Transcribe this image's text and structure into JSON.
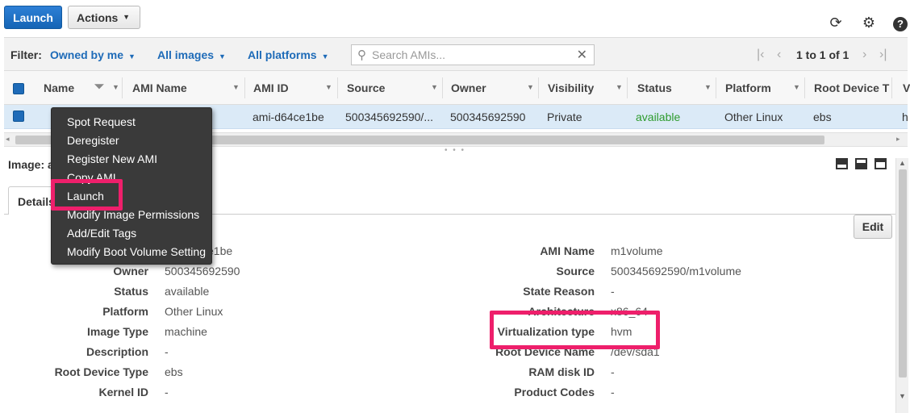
{
  "toolbar": {
    "launch_label": "Launch",
    "actions_label": "Actions",
    "refresh_icon": "refresh-icon",
    "settings_icon": "gear-icon",
    "help_icon": "help-icon"
  },
  "filter": {
    "label": "Filter:",
    "owned": "Owned by me",
    "images": "All images",
    "platforms": "All platforms",
    "search_placeholder": "Search AMIs...",
    "pager_text": "1 to 1 of 1"
  },
  "table": {
    "columns": [
      "Name",
      "AMI Name",
      "AMI ID",
      "Source",
      "Owner",
      "Visibility",
      "Status",
      "Platform",
      "Root Device T",
      "V"
    ],
    "row": {
      "ami_id": "ami-d64ce1be",
      "source": "500345692590/...",
      "owner": "500345692590",
      "visibility": "Private",
      "status": "available",
      "platform": "Other Linux",
      "root_device": "ebs",
      "v": "h"
    }
  },
  "context_menu": {
    "items": [
      "Spot Request",
      "Deregister",
      "Register New AMI",
      "Copy AMI",
      "Launch",
      "Modify Image Permissions",
      "Add/Edit Tags",
      "Modify Boot Volume Setting"
    ]
  },
  "detail": {
    "image_label": "Image: a",
    "tab_details": "Details",
    "edit_label": "Edit",
    "left": [
      {
        "label": "",
        "value": "e1be"
      },
      {
        "label": "Owner",
        "value": "500345692590"
      },
      {
        "label": "Status",
        "value": "available"
      },
      {
        "label": "Platform",
        "value": "Other Linux"
      },
      {
        "label": "Image Type",
        "value": "machine"
      },
      {
        "label": "Description",
        "value": "-"
      },
      {
        "label": "Root Device Type",
        "value": "ebs"
      },
      {
        "label": "Kernel ID",
        "value": "-"
      }
    ],
    "right": [
      {
        "label": "AMI Name",
        "value": "m1volume"
      },
      {
        "label": "Source",
        "value": "500345692590/m1volume"
      },
      {
        "label": "State Reason",
        "value": "-"
      },
      {
        "label": "Architecture",
        "value": "x86_64"
      },
      {
        "label": "Virtualization type",
        "value": "hvm"
      },
      {
        "label": "Root Device Name",
        "value": "/dev/sda1"
      },
      {
        "label": "RAM disk ID",
        "value": "-"
      },
      {
        "label": "Product Codes",
        "value": "-"
      }
    ]
  },
  "colors": {
    "primary": "#1e6bb8",
    "highlight": "#ee1f6b",
    "status_green": "#2d9b2d",
    "menu_bg": "#3a3a3a"
  }
}
